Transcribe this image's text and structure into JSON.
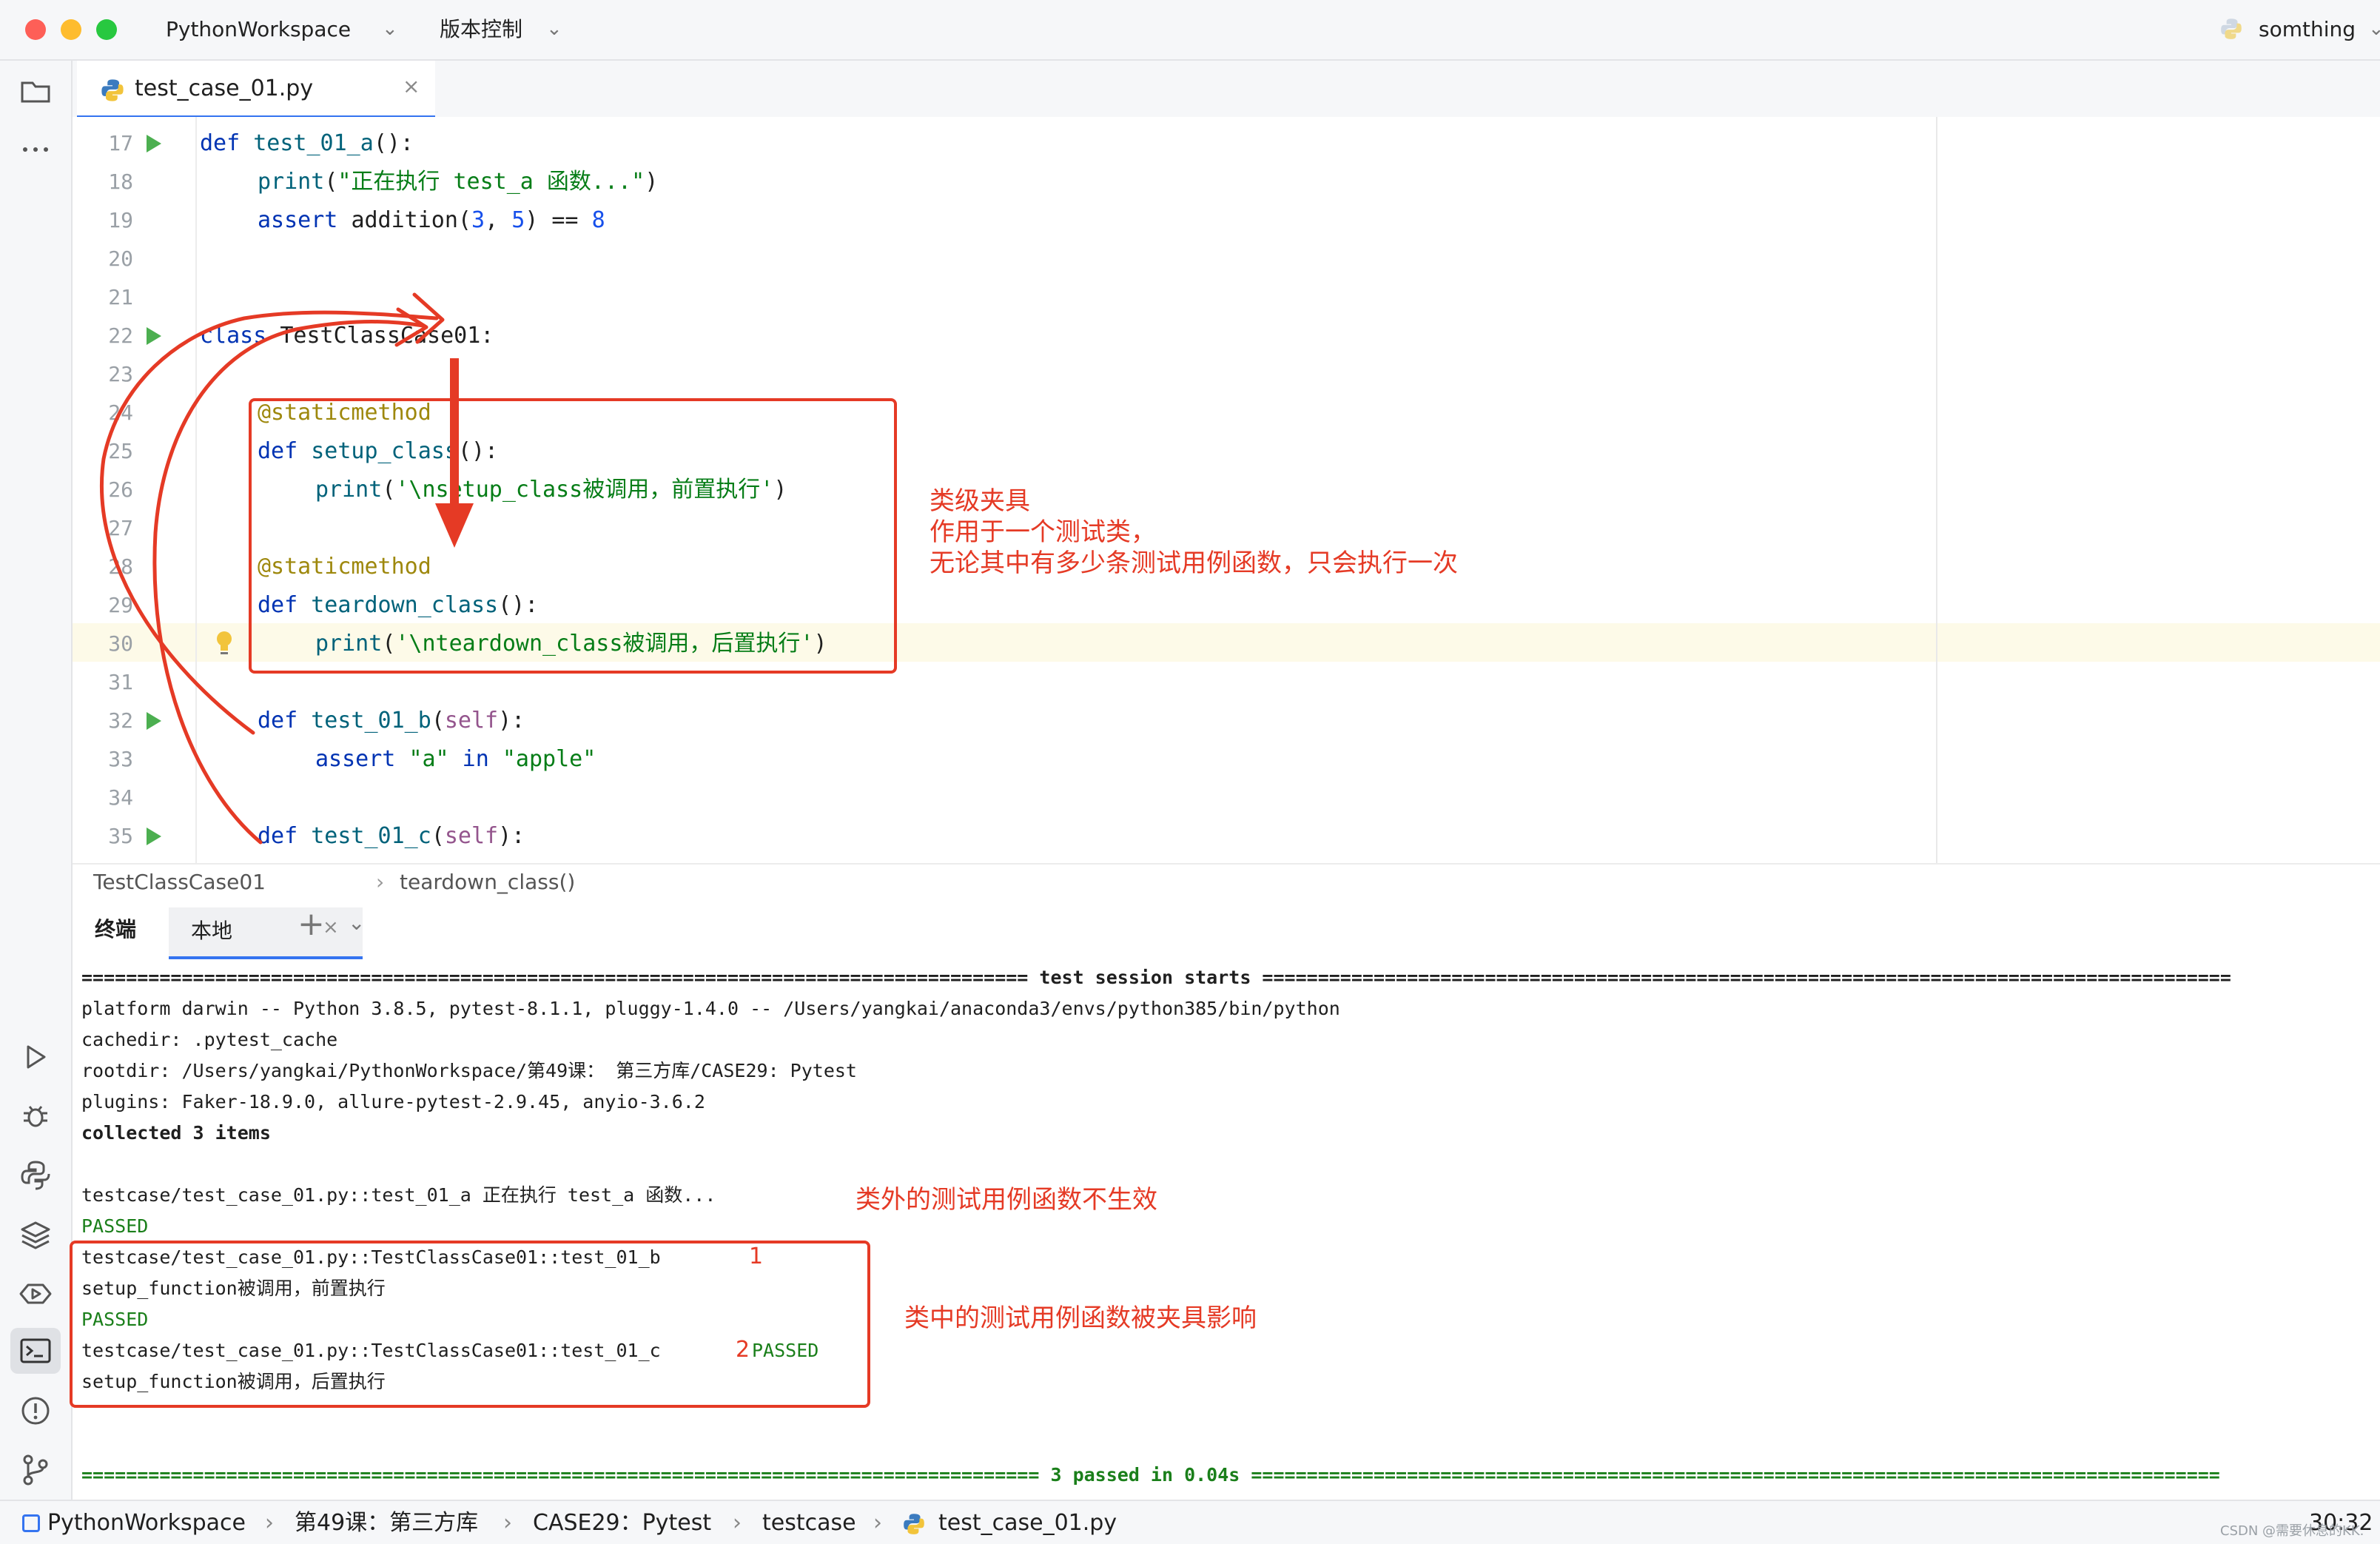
{
  "titlebar": {
    "project": "PythonWorkspace",
    "vcs": "版本控制",
    "right_label": "somthing"
  },
  "editor_tab": {
    "filename": "test_case_01.py",
    "close": "×"
  },
  "editor": {
    "lines": [
      {
        "n": "17",
        "run": true
      },
      {
        "n": "18",
        "run": false
      },
      {
        "n": "19",
        "run": false
      },
      {
        "n": "20",
        "run": false
      },
      {
        "n": "21",
        "run": false
      },
      {
        "n": "22",
        "run": true
      },
      {
        "n": "23",
        "run": false
      },
      {
        "n": "24",
        "run": false
      },
      {
        "n": "25",
        "run": false
      },
      {
        "n": "26",
        "run": false
      },
      {
        "n": "27",
        "run": false
      },
      {
        "n": "28",
        "run": false
      },
      {
        "n": "29",
        "run": false
      },
      {
        "n": "30",
        "run": false
      },
      {
        "n": "31",
        "run": false
      },
      {
        "n": "32",
        "run": true
      },
      {
        "n": "33",
        "run": false
      },
      {
        "n": "34",
        "run": false
      },
      {
        "n": "35",
        "run": true
      }
    ],
    "code": {
      "l17": {
        "kw": "def ",
        "fn": "test_01_a",
        "rest": "():"
      },
      "l18": {
        "fn": "print",
        "p1": "(",
        "st": "\"正在执行 test_a 函数...\"",
        "p2": ")"
      },
      "l19": {
        "kw": "assert ",
        "rest": "addition(",
        "n1": "3",
        "c": ", ",
        "n2": "5",
        "rest2": ") == ",
        "n3": "8"
      },
      "l22": {
        "kw": "class ",
        "rest": "TestClassCase01:"
      },
      "l24": {
        "de": "@staticmethod"
      },
      "l25": {
        "kw": "def ",
        "fn": "setup_class",
        "rest": "():"
      },
      "l26": {
        "fn": "print",
        "p1": "(",
        "st": "'\\nsetup_class被调用，前置执行'",
        "p2": ")"
      },
      "l28": {
        "de": "@staticmethod"
      },
      "l29": {
        "kw": "def ",
        "fn": "teardown_class",
        "rest": "():"
      },
      "l30": {
        "fn": "print",
        "p1": "(",
        "st": "'\\nteardown_class被调用，后置执行'",
        "p2": ")"
      },
      "l32": {
        "kw": "def ",
        "fn": "test_01_b",
        "p1": "(",
        "sf": "self",
        "p2": "):"
      },
      "l33": {
        "kw": "assert ",
        "st1": "\"a\"",
        "in": " in ",
        "st2": "\"apple\""
      },
      "l35": {
        "kw": "def ",
        "fn": "test_01_c",
        "p1": "(",
        "sf": "self",
        "p2": "):"
      }
    }
  },
  "breadcrumb": {
    "cls": "TestClassCase01",
    "sep": "›",
    "method": "teardown_class()"
  },
  "terminal": {
    "title": "终端",
    "tab": "本地",
    "close": "×",
    "plus": "+",
    "lines": {
      "session_start": "===================================================================================== test session starts =======================================================================================",
      "platform": "platform darwin -- Python 3.8.5, pytest-8.1.1, pluggy-1.4.0 -- /Users/yangkai/anaconda3/envs/python385/bin/python",
      "cachedir": "cachedir: .pytest_cache",
      "rootdir": "rootdir: /Users/yangkai/PythonWorkspace/第49课： 第三方库/CASE29: Pytest",
      "plugins": "plugins: Faker-18.9.0, allure-pytest-2.9.45, anyio-3.6.2",
      "collected": "collected 3 items",
      "t1": "testcase/test_case_01.py::test_01_a 正在执行 test_a 函数...",
      "passed1": "PASSED",
      "t2": "testcase/test_case_01.py::TestClassCase01::test_01_b",
      "setup": "setup_function被调用，前置执行",
      "passed2": "PASSED",
      "t3": "testcase/test_case_01.py::TestClassCase01::test_01_c",
      "passed3": "PASSED",
      "teardown": "setup_function被调用，后置执行",
      "summary": "====================================================================================== 3 passed in 0.04s ======================================================================================="
    }
  },
  "status": {
    "crumbs": [
      "PythonWorkspace",
      "第49课：第三方库",
      "CASE29：Pytest",
      "testcase",
      "test_case_01.py"
    ],
    "sep": "›",
    "position": "30:32"
  },
  "annotations": {
    "fixture_note": "类级夹具\n作用于一个测试类，\n无论其中有多少条测试用例函数，只会执行一次",
    "outside_note": "类外的测试用例函数不生效",
    "inside_note": "类中的测试用例函数被夹具影响",
    "num1": "1",
    "num2": "2"
  },
  "watermark": "CSDN @需要休息的KK.",
  "colors": {
    "accent": "#3574f0",
    "annotation": "#e53a25",
    "run": "#4caf50"
  },
  "icons": [
    "folder-icon",
    "more-icon",
    "run-icon",
    "debug-icon",
    "python-console-icon",
    "layers-icon",
    "services-icon",
    "terminal-icon",
    "problems-icon",
    "git-icon",
    "python-file-icon",
    "lightbulb-icon"
  ]
}
